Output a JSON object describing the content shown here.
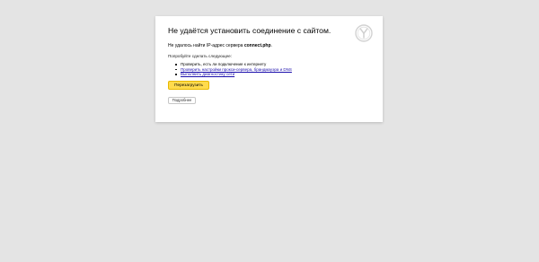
{
  "error": {
    "title": "Не удаётся установить соединение с сайтом.",
    "desc_prefix": "Не удалось найти IP-адрес сервера ",
    "host": "connect.php",
    "desc_suffix": ".",
    "try_label": "Попробуйте сделать следующее:",
    "suggestions": [
      "Проверить, есть ли подключение к интернету",
      "Проверить настройки прокси-сервера, брандмауэра и DNS",
      "Выполнить диагностику сети"
    ],
    "reload_label": "Перезагрузить",
    "details_label": "Подробнее"
  },
  "icons": {
    "logo": "yandex-browser-logo-icon"
  },
  "colors": {
    "page_bg": "#e4e4e4",
    "card_bg": "#ffffff",
    "link": "#1a0dab",
    "reload_button": "#ffdb4d"
  }
}
